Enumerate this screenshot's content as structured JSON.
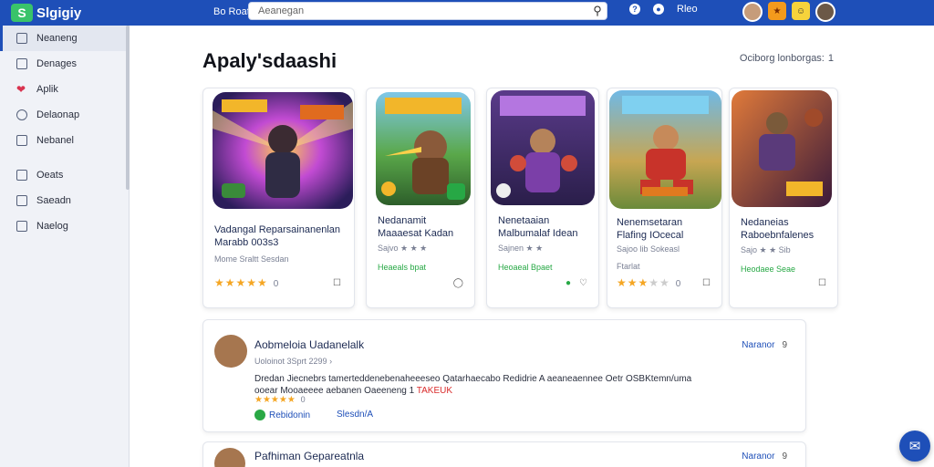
{
  "app": {
    "logo_letter": "S",
    "name": "Slgigiy"
  },
  "topbar": {
    "left_link": "Bo Roat",
    "search_placeholder": "Aeanegan",
    "right_link": "Rleo",
    "badge1": "★",
    "badge2": "☺"
  },
  "sidebar": {
    "items": [
      {
        "label": "Neaneng",
        "icon": "grid-icon",
        "active": true
      },
      {
        "label": "Denages",
        "icon": "apps-icon"
      },
      {
        "label": "Aplik",
        "icon": "heart-icon"
      },
      {
        "label": "Delaonap",
        "icon": "globe-icon"
      },
      {
        "label": "Nebanel",
        "icon": "home-icon"
      },
      {
        "label": "Oeats",
        "icon": "calendar-icon"
      },
      {
        "label": "Saeadn",
        "icon": "book-icon"
      },
      {
        "label": "Naelog",
        "icon": "lock-icon"
      }
    ]
  },
  "main": {
    "title": "Apaly'sdaashi",
    "sort_label": "Ociborg lonborgas:",
    "sort_value": "1"
  },
  "cards": [
    {
      "title1": "Vadangal Reparsainanenlan",
      "title2": "Marabb 003s3",
      "sub": "Mome Sraltt Sesdan",
      "green": "",
      "rating": "0",
      "stars": 5
    },
    {
      "title1": "Nedanamit",
      "title2": "Maaaesat Kadan",
      "sub": "Sajvo ★ ★ ★",
      "green": "Heaeals bpat",
      "rating": "",
      "stars": 0
    },
    {
      "title1": "Nenetaaian",
      "title2": "Malbumalaf Idean",
      "sub": "Sajnen ★ ★",
      "green": "Heoaeal Bpaet",
      "rating": "",
      "stars": 0
    },
    {
      "title1": "Nenemsetaran",
      "title2": "Flafing IOcecal",
      "sub": "Sajoo lib Sokeasl",
      "green": "Ftarlat",
      "rating": "0",
      "stars": 3
    },
    {
      "title1": "Nedaneias",
      "title2": "Raboebnfalenes",
      "sub": "Sajo ★ ★ Sib",
      "green": "Heodaee Seae",
      "rating": "",
      "stars": 0
    }
  ],
  "reviews": [
    {
      "name": "Aobmeloia Uadanelalk",
      "meta": "Uoloinot 3Sprt 2299",
      "meta_chevron": "›",
      "body": "Dredan Jiecnebrs tamerteddenebenaheeeseo Qatarhaecabo Redidrie A aeaneaennee Oetr OSBKtemn/uma",
      "body2": "ooear Mooaeeee aebanen Oaeeneng 1",
      "body_hl": "TAKEUK",
      "stars": "★★★★★",
      "rating": "0",
      "btn1": "Rebidonin",
      "btn2": "Slesdn/A",
      "right": "Naranor",
      "right_num": "9"
    },
    {
      "name": "Pafhiman Gepareatnla",
      "meta": "",
      "meta_chevron": "",
      "body": "",
      "body2": "",
      "body_hl": "",
      "stars": "",
      "rating": "",
      "btn1": "",
      "btn2": "",
      "right": "Naranor",
      "right_num": "9"
    }
  ],
  "colors": {
    "brand": "#1e4fb8",
    "star": "#f5a623",
    "green": "#27a845"
  }
}
